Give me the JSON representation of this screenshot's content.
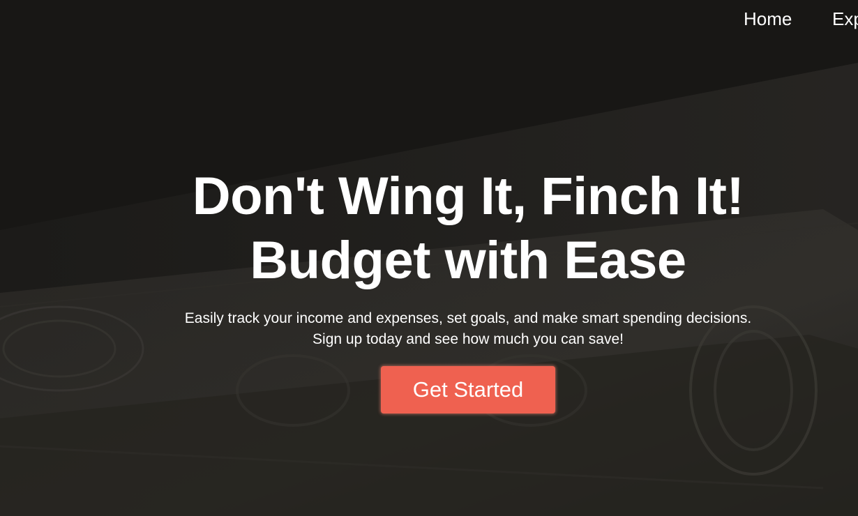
{
  "nav": {
    "home_label": "Home",
    "second_label": "Exp"
  },
  "hero": {
    "headline_line1": "Don't Wing It, Finch It!",
    "headline_line2": "Budget with Ease",
    "subtitle_line1": "Easily track your income and expenses, set goals, and make smart spending decisions.",
    "subtitle_line2": "Sign up today and see how much you can save!",
    "cta_label": "Get Started",
    "background_image": "money-bills-icon"
  },
  "colors": {
    "background": "#181715",
    "cta": "#ef6150",
    "text": "#ffffff"
  }
}
